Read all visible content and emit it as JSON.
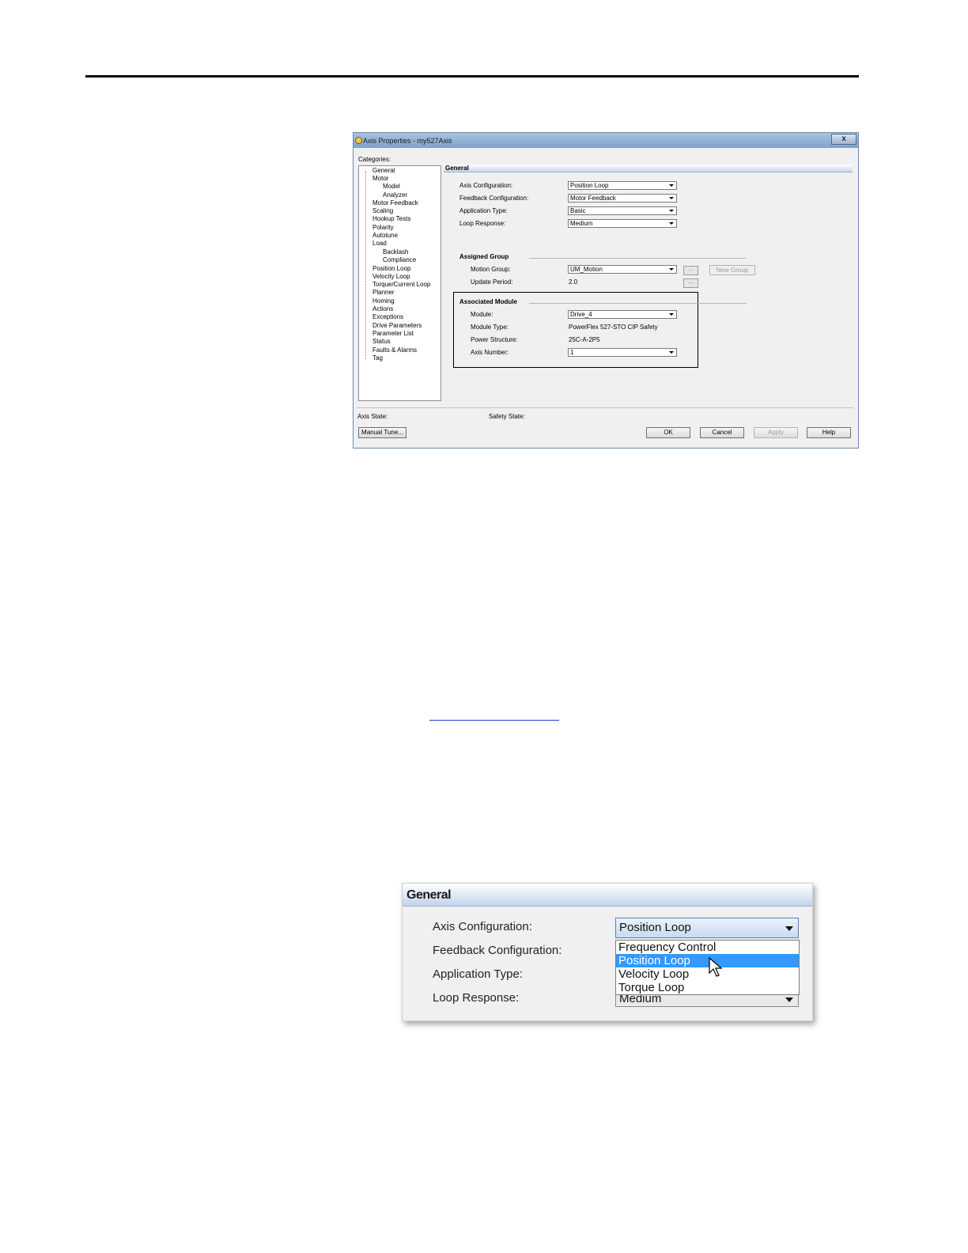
{
  "dialog": {
    "title": "Axis Properties - my527Axis",
    "close_label": "x",
    "categories_label": "Categories:",
    "tree_items": [
      "General",
      "Motor",
      "Model",
      "Analyzer",
      "Motor Feedback",
      "Scaling",
      "Hookup Tests",
      "Polarity",
      "Autotune",
      "Load",
      "Backlash",
      "Compliance",
      "Position Loop",
      "Velocity Loop",
      "Torque/Current Loop",
      "Planner",
      "Homing",
      "Actions",
      "Exceptions",
      "Drive Parameters",
      "Parameter List",
      "Status",
      "Faults & Alarms",
      "Tag"
    ],
    "panel_title": "General",
    "fields": {
      "axis_configuration": {
        "label": "Axis Configuration:",
        "value": "Position Loop"
      },
      "feedback_configuration": {
        "label": "Feedback Configuration:",
        "value": "Motor Feedback"
      },
      "application_type": {
        "label": "Application Type:",
        "value": "Basic"
      },
      "loop_response": {
        "label": "Loop Response:",
        "value": "Medium"
      }
    },
    "assigned_group": {
      "title": "Assigned Group",
      "motion_group_label": "Motion Group:",
      "motion_group_value": "UM_Motion",
      "ellipsis": "...",
      "new_group_label": "New Group",
      "update_period_label": "Update Period:",
      "update_period_value": "2.0"
    },
    "associated_module": {
      "title": "Associated Module",
      "module_label": "Module:",
      "module_value": "Drive_4",
      "module_type_label": "Module Type:",
      "module_type_value": "PowerFlex 527-STO CIP Safety",
      "power_structure_label": "Power Structure:",
      "power_structure_value": "25C-A-2P5",
      "axis_number_label": "Axis Number:",
      "axis_number_value": "1"
    },
    "axis_state_label": "Axis State:",
    "safety_state_label": "Safety State:",
    "buttons": {
      "manual_tune": "Manual Tune...",
      "ok": "OK",
      "cancel": "Cancel",
      "apply": "Apply",
      "help": "Help"
    }
  },
  "crop": {
    "header": "General",
    "labels": [
      "Axis Configuration:",
      "Feedback Configuration:",
      "Application Type:",
      "Loop Response:"
    ],
    "axis_config_value": "Position Loop",
    "loop_response_value": "Medium",
    "dropdown_options": [
      "Frequency Control",
      "Position Loop",
      "Velocity Loop",
      "Torque Loop"
    ],
    "selected_option": "Position Loop"
  }
}
